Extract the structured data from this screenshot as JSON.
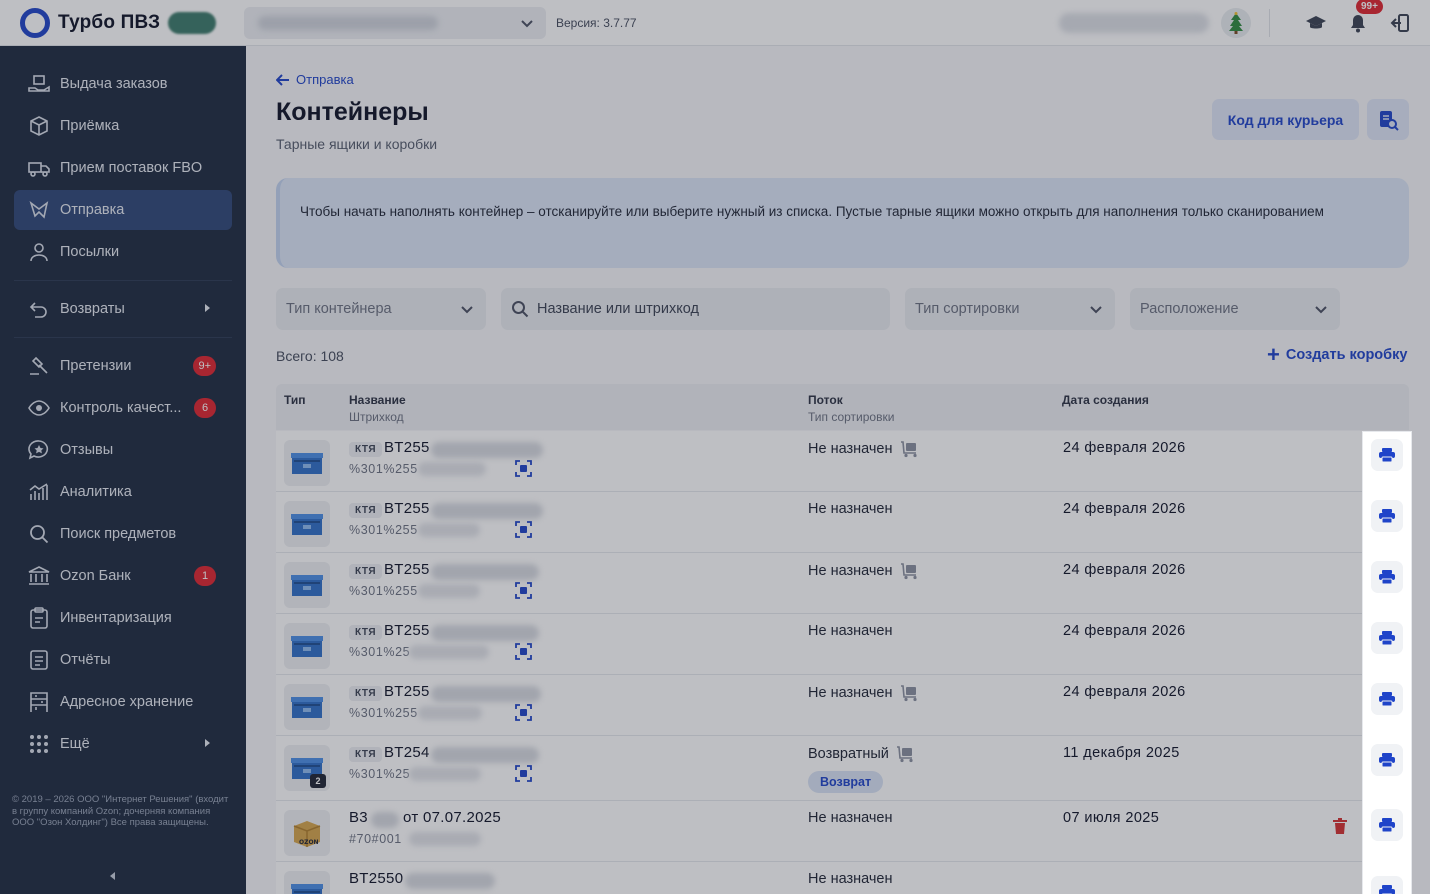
{
  "header": {
    "app_name": "Турбо ПВЗ",
    "version": "Версия: 3.7.77",
    "notifications_badge": "99+"
  },
  "sidebar": {
    "items": [
      {
        "label": "Выдача заказов",
        "icon": "handover-icon"
      },
      {
        "label": "Приёмка",
        "icon": "box-icon"
      },
      {
        "label": "Прием поставок FBO",
        "icon": "truck-icon"
      },
      {
        "label": "Отправка",
        "icon": "send-icon",
        "active": true
      },
      {
        "label": "Посылки",
        "icon": "person-icon"
      },
      {
        "label": "Возвраты",
        "icon": "return-icon",
        "arrow": true
      },
      {
        "label": "Претензии",
        "icon": "gavel-icon",
        "count": "9+"
      },
      {
        "label": "Контроль качест...",
        "icon": "eye-icon",
        "count": "6"
      },
      {
        "label": "Отзывы",
        "icon": "star-chat-icon"
      },
      {
        "label": "Аналитика",
        "icon": "chart-icon"
      },
      {
        "label": "Поиск предметов",
        "icon": "search-icon"
      },
      {
        "label": "Ozon Банк",
        "icon": "bank-icon",
        "count": "1"
      },
      {
        "label": "Инвентаризация",
        "icon": "clipboard-icon"
      },
      {
        "label": "Отчёты",
        "icon": "report-icon"
      },
      {
        "label": "Адресное хранение",
        "icon": "storage-icon"
      },
      {
        "label": "Ещё",
        "icon": "dots-icon",
        "arrow": true
      }
    ],
    "copyright": "© 2019 – 2026 ООО \"Интернет Решения\" (входит в группу компаний Ozon; дочерняя компания ООО \"Озон Холдинг\") Все права защищены."
  },
  "page": {
    "back_label": "Отправка",
    "title": "Контейнеры",
    "subtitle": "Тарные ящики и коробки",
    "courier_button": "Код для курьера",
    "info_text": "Чтобы начать наполнять контейнер – отсканируйте или выберите нужный из списка. Пустые тарные ящики можно открыть для наполнения только сканированием",
    "filters": {
      "container_type": "Тип контейнера",
      "search_placeholder": "Название или штрихкод",
      "sort_type": "Тип сортировки",
      "location": "Расположение"
    },
    "total": "Всего: 108",
    "create_box": "Создать коробку"
  },
  "table": {
    "headers": {
      "type": "Тип",
      "name": "Название",
      "barcode": "Штрихкод",
      "flow": "Поток",
      "sort_type": "Тип сортировки",
      "created": "Дата создания"
    },
    "rows": [
      {
        "tag": "КТЯ",
        "name": "BT255",
        "barcode": "%301%255",
        "flow": "Не назначен",
        "flow_icon": true,
        "date": "24 февраля 2026"
      },
      {
        "tag": "КТЯ",
        "name": "BT255",
        "barcode": "%301%255",
        "flow": "Не назначен",
        "flow_icon": false,
        "date": "24 февраля 2026"
      },
      {
        "tag": "КТЯ",
        "name": "BT255",
        "barcode": "%301%255",
        "flow": "Не назначен",
        "flow_icon": true,
        "date": "24 февраля 2026"
      },
      {
        "tag": "КТЯ",
        "name": "BT255",
        "barcode": "%301%25",
        "flow": "Не назначен",
        "flow_icon": false,
        "date": "24 февраля 2026"
      },
      {
        "tag": "КТЯ",
        "name": "BT255",
        "barcode": "%301%255",
        "flow": "Не назначен",
        "flow_icon": true,
        "date": "24 февраля 2026"
      },
      {
        "tag": "КТЯ",
        "name": "BT254",
        "barcode": "%301%25",
        "flow": "Возвратный",
        "flow_icon": true,
        "flow_tag": "Возврат",
        "date": "11 декабря 2025",
        "count": "2"
      },
      {
        "tag": "",
        "name": "B3",
        "name_suffix": "от 07.07.2025",
        "barcode": "#70#001",
        "flow": "Не назначен",
        "flow_icon": false,
        "date": "07 июля 2025"
      },
      {
        "tag": "",
        "name": "BT2550",
        "barcode": "",
        "flow": "Не назначен",
        "flow_icon": false,
        "date": ""
      }
    ]
  },
  "colors": {
    "accent": "#1f44c9",
    "sidebar_bg": "#1e2a40",
    "sidebar_active": "#2f4778",
    "badge": "#e0242f"
  }
}
